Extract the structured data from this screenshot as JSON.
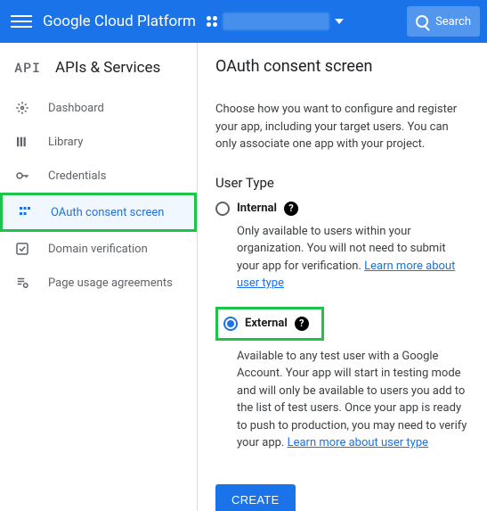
{
  "topbar": {
    "brand": "Google Cloud Platform",
    "search_placeholder": "Search"
  },
  "sidebar": {
    "section": "APIs & Services",
    "items": [
      {
        "label": "Dashboard"
      },
      {
        "label": "Library"
      },
      {
        "label": "Credentials"
      },
      {
        "label": "OAuth consent screen"
      },
      {
        "label": "Domain verification"
      },
      {
        "label": "Page usage agreements"
      }
    ]
  },
  "main": {
    "title": "OAuth consent screen",
    "intro": "Choose how you want to configure and register your app, including your target users. You can only associate one app with your project.",
    "section": "User Type",
    "internal": {
      "label": "Internal",
      "desc": "Only available to users within your organization. You will not need to submit your app for verification. ",
      "link": "Learn more about user type"
    },
    "external": {
      "label": "External",
      "desc": "Available to any test user with a Google Account. Your app will start in testing mode and will only be available to users you add to the list of test users. Once your app is ready to push to production, you may need to verify your app. ",
      "link": "Learn more about user type"
    },
    "create": "CREATE"
  }
}
